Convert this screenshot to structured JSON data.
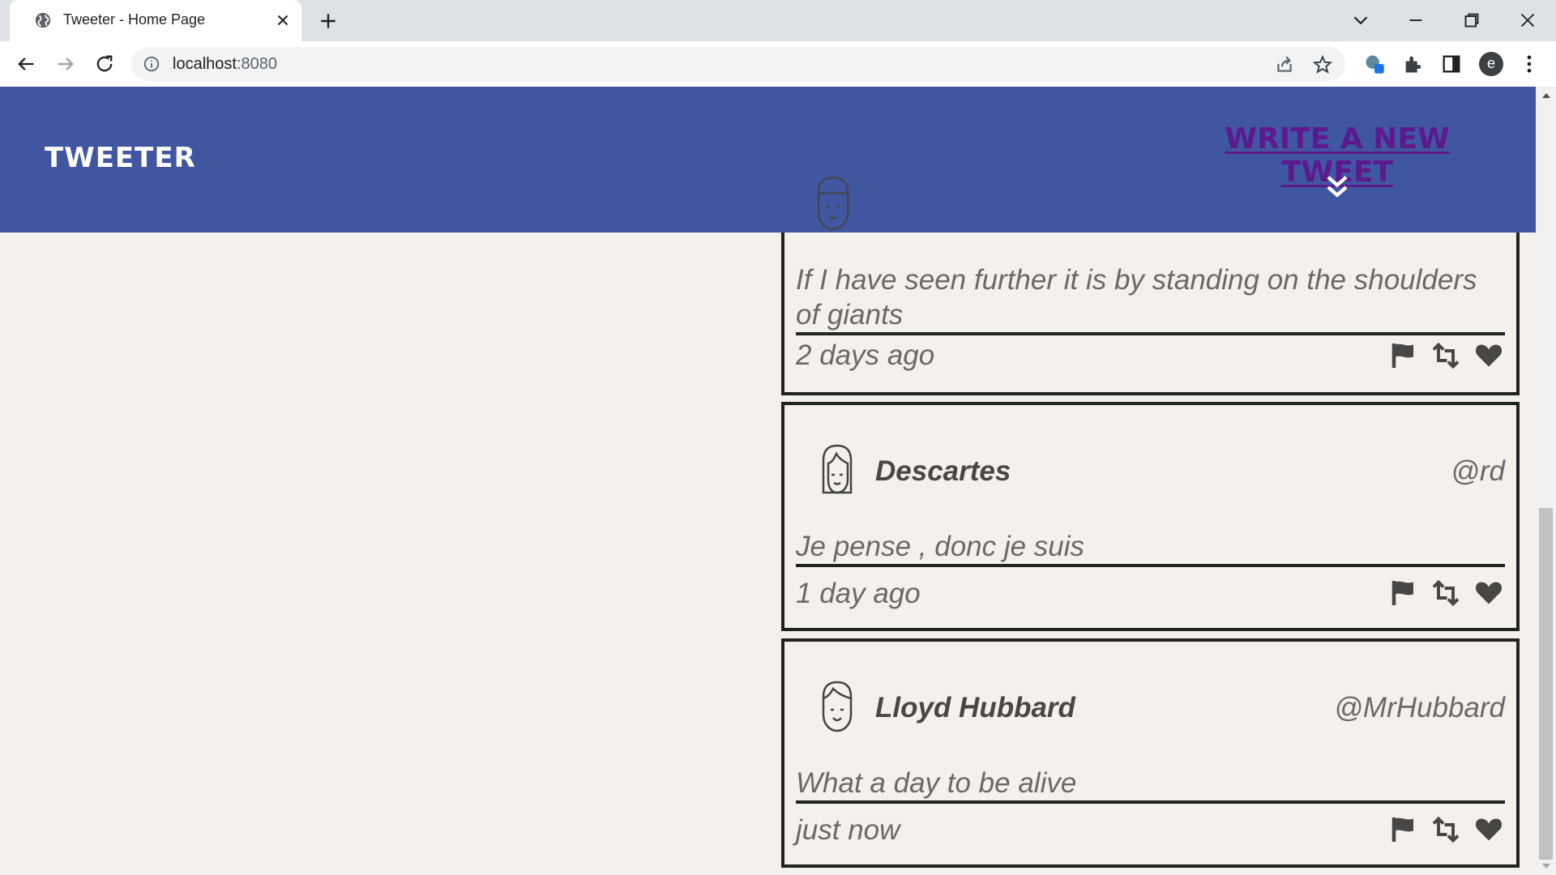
{
  "browser": {
    "tab_title": "Tweeter - Home Page",
    "url_host": "localhost",
    "url_port": ":8080",
    "profile_initial": "e"
  },
  "header": {
    "brand": "TWEETER",
    "write_link": "WRITE A NEW TWEET"
  },
  "tweets": [
    {
      "name": "",
      "handle": "",
      "text": "If I have seen further it is by standing on the shoulders of giants",
      "time": "2 days ago"
    },
    {
      "name": "Descartes",
      "handle": "@rd",
      "text": "Je pense , donc je suis",
      "time": "1 day ago"
    },
    {
      "name": "Lloyd Hubbard",
      "handle": "@MrHubbard",
      "text": "What a day to be alive",
      "time": "just now"
    }
  ],
  "colors": {
    "header_bg": "#4056a1",
    "page_bg": "#f4f1ec",
    "link": "#5c1a8c",
    "text": "#6b6868",
    "border": "#222222"
  },
  "icons": {
    "actions": [
      "flag-icon",
      "retweet-icon",
      "heart-icon"
    ]
  }
}
